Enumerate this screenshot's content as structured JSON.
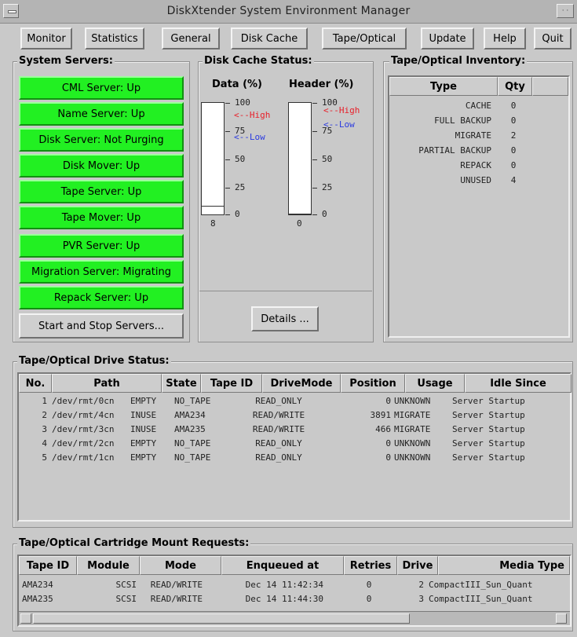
{
  "window": {
    "title": "DiskXtender System Environment Manager",
    "max_glyph": "· ·"
  },
  "menu": [
    {
      "label": "Monitor"
    },
    {
      "label": "Statistics"
    },
    {
      "label": "General"
    },
    {
      "label": "Disk Cache"
    },
    {
      "label": "Tape/Optical"
    },
    {
      "label": "Update"
    },
    {
      "label": "Help"
    },
    {
      "label": "Quit"
    }
  ],
  "system_servers": {
    "title": "System Servers:",
    "servers": [
      "CML Server: Up",
      "Name Server: Up",
      "Disk Server: Not Purging",
      "Disk Mover: Up",
      "Tape Server: Up",
      "Tape Mover: Up",
      "PVR Server: Up",
      "Migration Server: Migrating",
      "Repack Server: Up"
    ],
    "start_stop_label": "Start and Stop Servers...",
    "status_color": "#22f022"
  },
  "disk_cache": {
    "title": "Disk Cache Status:",
    "data_label": "Data (%)",
    "header_label": "Header (%)",
    "scale": [
      "100",
      "75",
      "50",
      "25",
      "0"
    ],
    "high_marker": "<--High",
    "low_marker": "<--Low",
    "high_color": "#e8202a",
    "low_color": "#2b3be0",
    "data_value": "8",
    "data_fill_fraction": 0.08,
    "header_value": "0",
    "header_fill_fraction": 0.0,
    "details_label": "Details ..."
  },
  "inventory": {
    "title": "Tape/Optical Inventory:",
    "columns": [
      "Type",
      "Qty"
    ],
    "rows": [
      {
        "type": "CACHE",
        "qty": "0"
      },
      {
        "type": "FULL BACKUP",
        "qty": "0"
      },
      {
        "type": "MIGRATE",
        "qty": "2"
      },
      {
        "type": "PARTIAL BACKUP",
        "qty": "0"
      },
      {
        "type": "REPACK",
        "qty": "0"
      },
      {
        "type": "UNUSED",
        "qty": "4"
      }
    ]
  },
  "drive_status": {
    "title": "Tape/Optical Drive Status:",
    "columns": [
      "No.",
      "Path",
      "State",
      "Tape ID",
      "DriveMode",
      "Position",
      "Usage",
      "Idle Since"
    ],
    "rows": [
      {
        "no": "1",
        "path": "/dev/rmt/0cn",
        "state": "EMPTY",
        "tape": "NO_TAPE",
        "mode": "READ_ONLY",
        "pos": "0",
        "usage": "UNKNOWN",
        "idle": "Server Startup"
      },
      {
        "no": "2",
        "path": "/dev/rmt/4cn",
        "state": "INUSE",
        "tape": "AMA234",
        "mode": "READ/WRITE",
        "pos": "3891",
        "usage": "MIGRATE",
        "idle": "Server Startup"
      },
      {
        "no": "3",
        "path": "/dev/rmt/3cn",
        "state": "INUSE",
        "tape": "AMA235",
        "mode": "READ/WRITE",
        "pos": "466",
        "usage": "MIGRATE",
        "idle": "Server Startup"
      },
      {
        "no": "4",
        "path": "/dev/rmt/2cn",
        "state": "EMPTY",
        "tape": "NO_TAPE",
        "mode": "READ_ONLY",
        "pos": "0",
        "usage": "UNKNOWN",
        "idle": "Server Startup"
      },
      {
        "no": "5",
        "path": "/dev/rmt/1cn",
        "state": "EMPTY",
        "tape": "NO_TAPE",
        "mode": "READ_ONLY",
        "pos": "0",
        "usage": "UNKNOWN",
        "idle": "Server Startup"
      }
    ]
  },
  "mount_requests": {
    "title": "Tape/Optical Cartridge Mount Requests:",
    "columns": [
      "Tape ID",
      "Module",
      "Mode",
      "Enqueued at",
      "Retries",
      "Drive",
      "Media Type"
    ],
    "rows": [
      {
        "tape": "AMA234",
        "module": "SCSI",
        "mode": "READ/WRITE",
        "enq": "Dec 14 11:42:34",
        "retries": "0",
        "drive": "2",
        "media": "CompactIII_Sun_Quant"
      },
      {
        "tape": "AMA235",
        "module": "SCSI",
        "mode": "READ/WRITE",
        "enq": "Dec 14 11:44:30",
        "retries": "0",
        "drive": "3",
        "media": "CompactIII_Sun_Quant"
      }
    ]
  }
}
